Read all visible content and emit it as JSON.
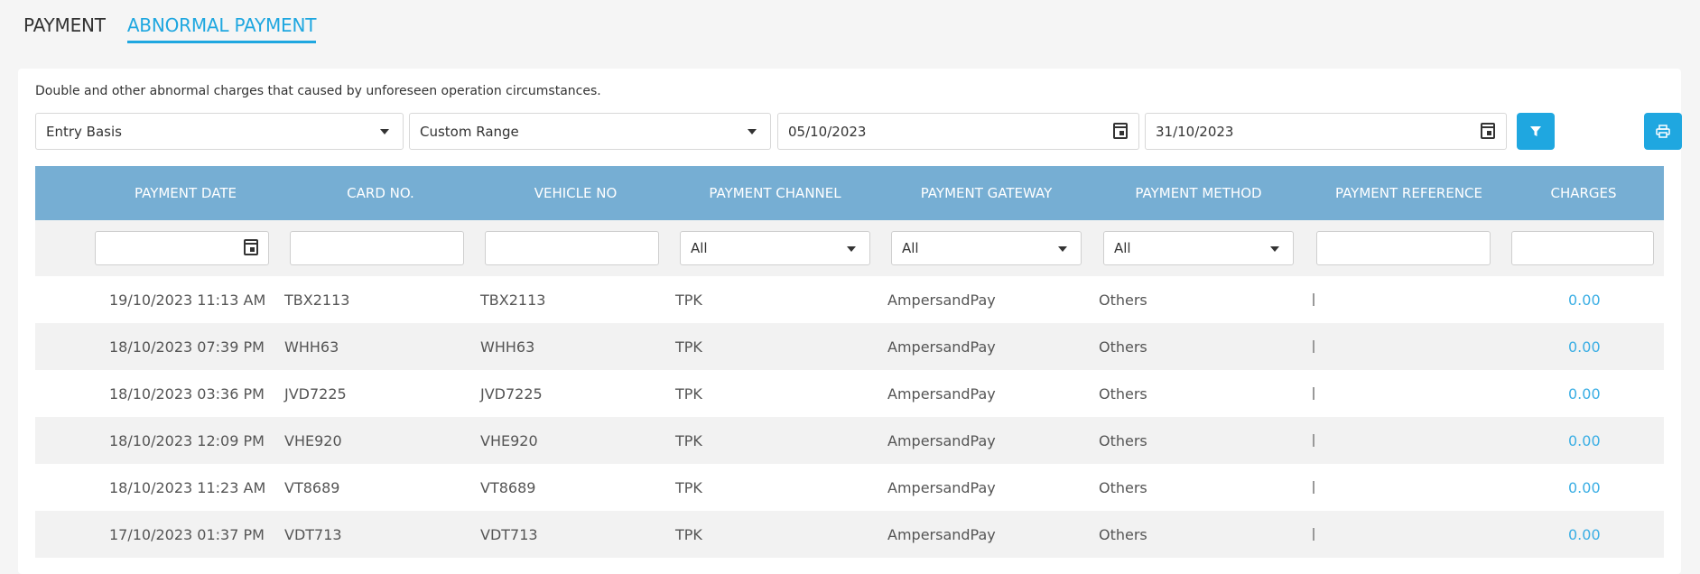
{
  "tabs": [
    {
      "label": "PAYMENT",
      "active": false
    },
    {
      "label": "ABNORMAL PAYMENT",
      "active": true
    }
  ],
  "description": "Double and other abnormal charges that caused by unforeseen operation circumstances.",
  "filters": {
    "basis": "Entry Basis",
    "range": "Custom Range",
    "date_from": "05/10/2023",
    "date_to": "31/10/2023"
  },
  "columns": [
    "PAYMENT DATE",
    "CARD NO.",
    "VEHICLE NO",
    "PAYMENT CHANNEL",
    "PAYMENT GATEWAY",
    "PAYMENT METHOD",
    "PAYMENT REFERENCE",
    "CHARGES"
  ],
  "column_filters": {
    "channel": "All",
    "gateway": "All",
    "method": "All"
  },
  "rows": [
    {
      "date": "19/10/2023 11:13 AM",
      "card": "TBX2113",
      "vehicle": "TBX2113",
      "channel": "TPK",
      "gateway": "AmpersandPay",
      "method": "Others",
      "charges": "0.00"
    },
    {
      "date": "18/10/2023 07:39 PM",
      "card": "WHH63",
      "vehicle": "WHH63",
      "channel": "TPK",
      "gateway": "AmpersandPay",
      "method": "Others",
      "charges": "0.00"
    },
    {
      "date": "18/10/2023 03:36 PM",
      "card": "JVD7225",
      "vehicle": "JVD7225",
      "channel": "TPK",
      "gateway": "AmpersandPay",
      "method": "Others",
      "charges": "0.00"
    },
    {
      "date": "18/10/2023 12:09 PM",
      "card": "VHE920",
      "vehicle": "VHE920",
      "channel": "TPK",
      "gateway": "AmpersandPay",
      "method": "Others",
      "charges": "0.00"
    },
    {
      "date": "18/10/2023 11:23 AM",
      "card": "VT8689",
      "vehicle": "VT8689",
      "channel": "TPK",
      "gateway": "AmpersandPay",
      "method": "Others",
      "charges": "0.00"
    },
    {
      "date": "17/10/2023 01:37 PM",
      "card": "VDT713",
      "vehicle": "VDT713",
      "channel": "TPK",
      "gateway": "AmpersandPay",
      "method": "Others",
      "charges": "0.00"
    }
  ],
  "colors": {
    "accent": "#1fa7e0",
    "header": "#76aed3",
    "charge": "#3aaee4"
  }
}
